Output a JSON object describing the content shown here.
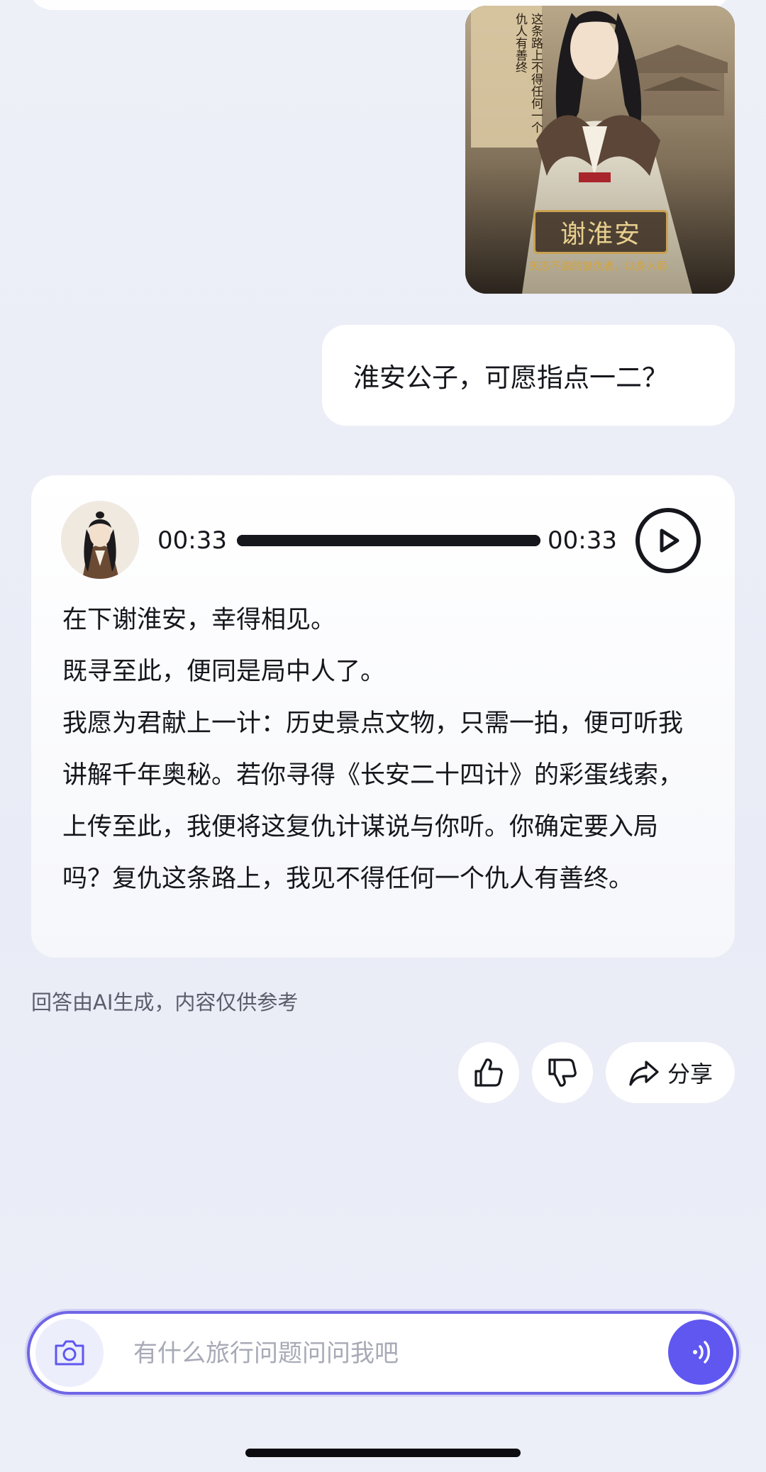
{
  "image_card": {
    "title": "谢淮安",
    "tagline": "矢志不渝的复仇者，以身入局",
    "vertical_text": "这条路上不得任何一个仇人有善终"
  },
  "user_message": "淮安公子，可愿指点一二？",
  "audio": {
    "current_time": "00:33",
    "total_time": "00:33",
    "progress": 1.0
  },
  "reply": {
    "lines": [
      "在下谢淮安，幸得相见。",
      "既寻至此，便同是局中人了。",
      "我愿为君献上一计：历史景点文物，只需一拍，便可听我讲解千年奥秘。若你寻得《长安二十四计》的彩蛋线索，上传至此，我便将这复仇计谋说与你听。你确定要入局吗？复仇这条路上，我见不得任何一个仇人有善终。"
    ]
  },
  "disclaimer": "回答由AI生成，内容仅供参考",
  "actions": {
    "like_icon": "thumbs-up-icon",
    "dislike_icon": "thumbs-down-icon",
    "share_label": "分享"
  },
  "input": {
    "placeholder": "有什么旅行问题问问我吧",
    "value": ""
  },
  "colors": {
    "accent": "#5f57f0",
    "input_border": "#6f66e6",
    "background": "#eceef7"
  }
}
